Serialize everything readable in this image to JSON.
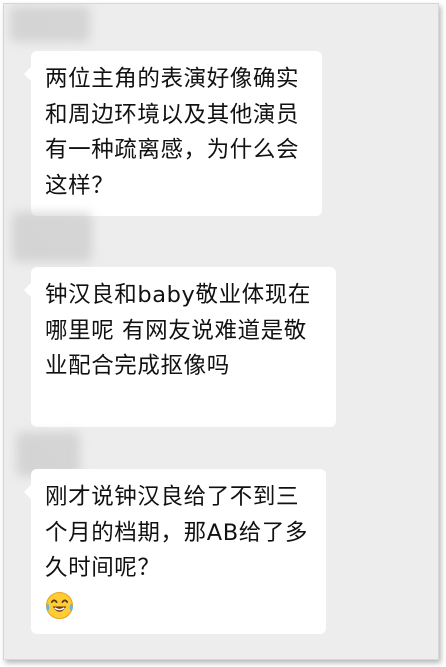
{
  "chat": {
    "messages": [
      {
        "text": "两位主角的表演好像确实和周边环境以及其他演员有一种疏离感，为什么会这样？"
      },
      {
        "text": "钟汉良和baby敬业体现在哪里呢 有网友说难道是敬业配合完成抠像吗"
      },
      {
        "text": "刚才说钟汉良给了不到三个月的档期，那AB给了多久时间呢？",
        "emoji": "tears-of-joy-emoji"
      }
    ]
  },
  "colors": {
    "background": "#ededed",
    "bubble": "#ffffff",
    "text": "#111111"
  }
}
